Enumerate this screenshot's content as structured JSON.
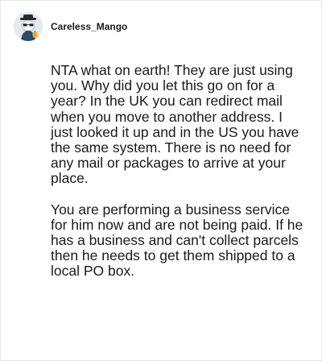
{
  "comment": {
    "username": "Careless_Mango",
    "avatar_icon": "snoo-avatar-icon",
    "paragraphs": [
      "NTA what on earth! They are just using you. Why did you let this go on for a year? In the UK you can redirect mail when you move to another address. I just looked it up and in the US you have the same system. There is no need for any mail or packages to arrive at your place.",
      "You are performing a business service for him now and are not being paid. If he has a business and can't collect parcels then he needs to get them shipped to a local PO box."
    ]
  },
  "colors": {
    "text": "#1a1a1b",
    "border": "#e6e6e6",
    "background": "#ffffff"
  }
}
